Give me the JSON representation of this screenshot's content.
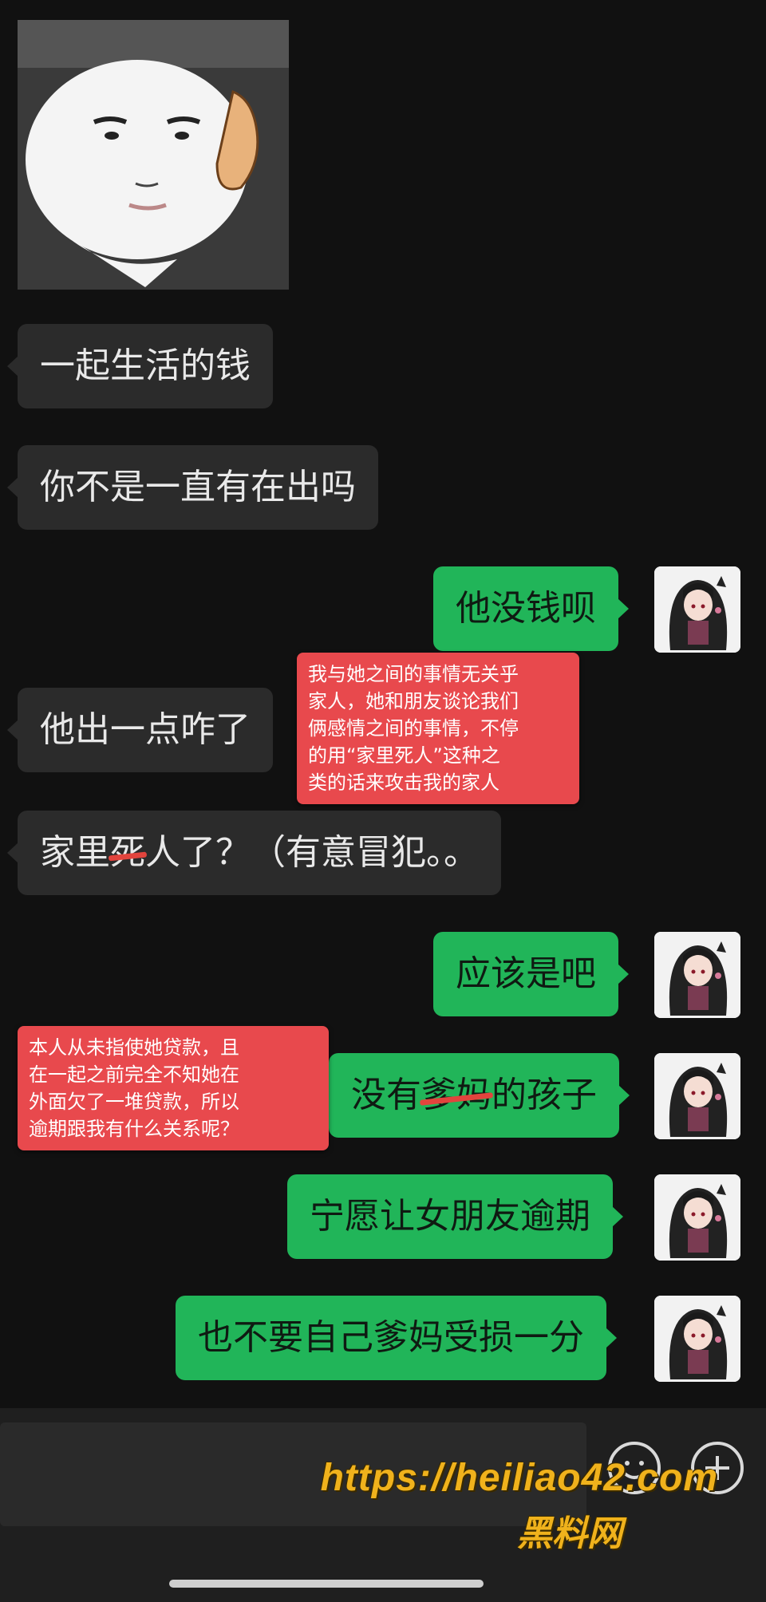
{
  "messages": [
    {
      "side": "left",
      "text": "一起生活的钱"
    },
    {
      "side": "left",
      "text": "你不是一直有在出吗"
    },
    {
      "side": "right",
      "text": "他没钱呗"
    },
    {
      "side": "left",
      "text": "他出一点咋了"
    },
    {
      "side": "left",
      "text_before": "家里",
      "text_struck": "死",
      "text_after": "人了？（有意冒犯。。"
    },
    {
      "side": "right",
      "text": "应该是吧"
    },
    {
      "side": "right",
      "text_before": "没有",
      "text_struck": "爹妈",
      "text_after": "的孩子"
    },
    {
      "side": "right",
      "text": "宁愿让女朋友逾期"
    },
    {
      "side": "right",
      "text": "也不要自己爹妈受损一分"
    }
  ],
  "notes": {
    "note1": [
      "我与她之间的事情无关乎",
      "家人，她和朋友谈论我们",
      "俩感情之间的事情，不停",
      "的用“家里死人”这种之",
      "类的话来攻击我的家人"
    ],
    "note2": [
      "本人从未指使她贷款，且",
      "在一起之前完全不知她在",
      "外面欠了一堆贷款，所以",
      "逾期跟我有什么关系呢？"
    ]
  },
  "watermark": {
    "url": "https://heiliao42.com",
    "site": "黑料网"
  },
  "colors": {
    "background": "#111111",
    "bubble_left": "#2b2b2b",
    "bubble_right": "#21b559",
    "note_red": "#e8494d",
    "watermark": "#f0b21c"
  },
  "icons": [
    "emoji-icon",
    "plus-icon",
    "sticker-image",
    "avatar-anime-girl"
  ]
}
